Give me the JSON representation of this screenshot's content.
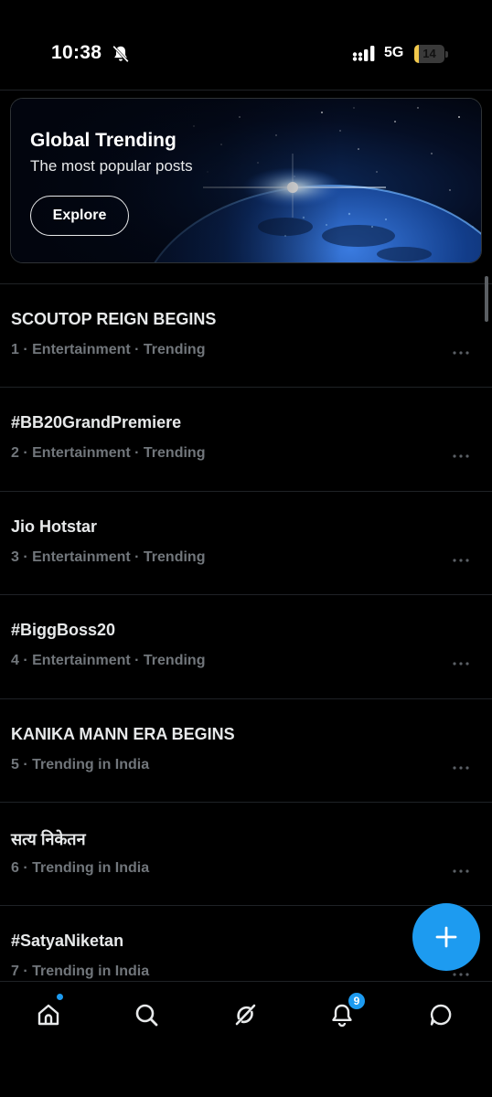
{
  "status_bar": {
    "time": "10:38",
    "network": "5G",
    "battery_level": "14",
    "battery_fraction": 0.14,
    "icons": [
      "bell-off-icon",
      "signal-icon",
      "battery-icon"
    ]
  },
  "banner": {
    "title": "Global Trending",
    "subtitle": "The most popular posts",
    "button_label": "Explore"
  },
  "trends": [
    {
      "title": "SCOUTOP REIGN BEGINS",
      "meta": "1 · Entertainment · Trending"
    },
    {
      "title": "#BB20GrandPremiere",
      "meta": "2 · Entertainment · Trending"
    },
    {
      "title": "Jio Hotstar",
      "meta": "3 · Entertainment · Trending"
    },
    {
      "title": "#BiggBoss20",
      "meta": "4 · Entertainment · Trending"
    },
    {
      "title": "KANIKA MANN ERA BEGINS",
      "meta": "5 · Trending in India"
    },
    {
      "title": "सत्य निकेतन",
      "meta": "6 · Trending in India"
    },
    {
      "title": "#SatyaNiketan",
      "meta": "7 · Trending in India"
    }
  ],
  "bottom_nav": {
    "items": [
      "home-icon",
      "search-icon",
      "grok-icon",
      "notifications-icon",
      "messages-icon"
    ],
    "notification_count": "9"
  },
  "colors": {
    "accent": "#1d9bf0",
    "background": "#000000",
    "text_primary": "#e7e9ea",
    "text_secondary": "#71767b",
    "divider": "#1f2226"
  }
}
